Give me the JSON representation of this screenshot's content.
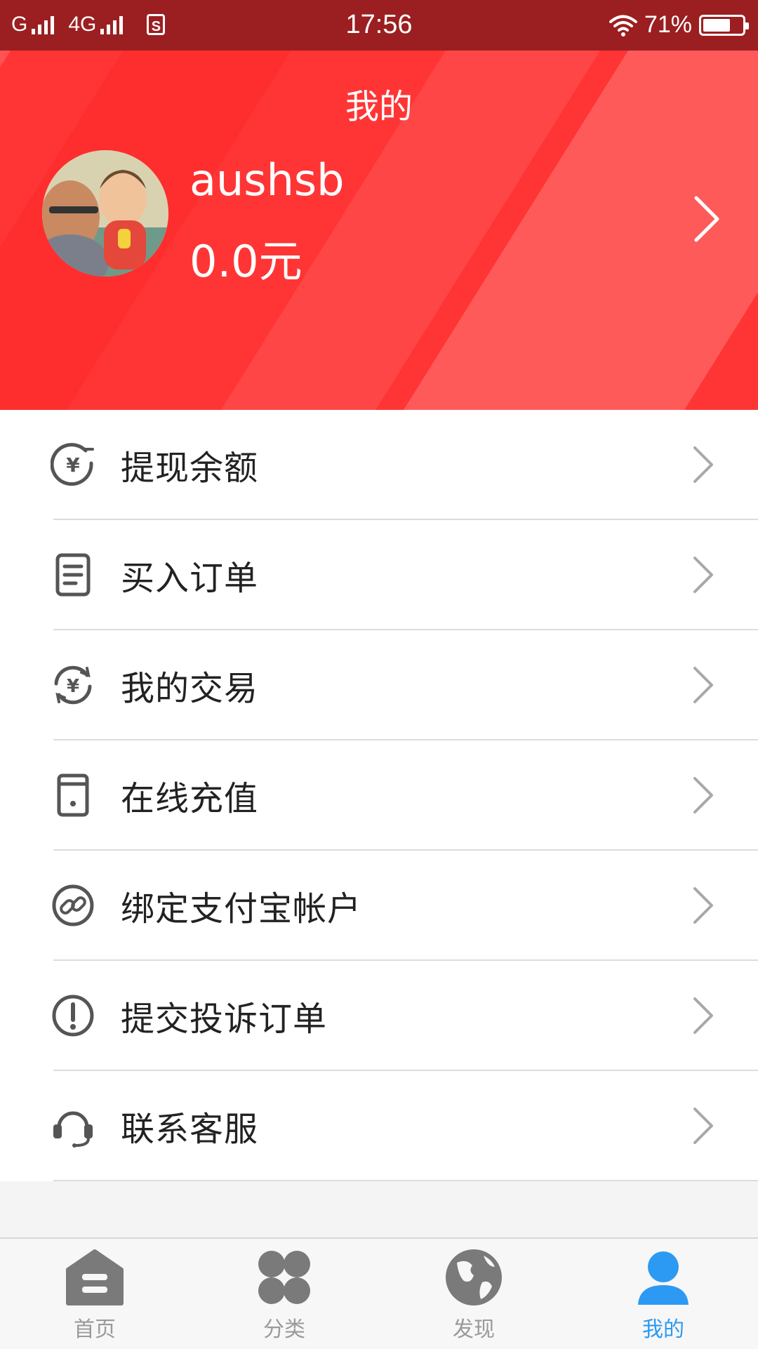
{
  "status_bar": {
    "carrier1": "G",
    "carrier2": "4G",
    "sim_label": "S",
    "time": "17:56",
    "battery": "71%",
    "battery_level": 0.71
  },
  "header": {
    "title": "我的",
    "username": "aushsb",
    "balance": "0.0元"
  },
  "menu": {
    "items": [
      {
        "label": "提现余额",
        "icon": "yen-withdraw-icon"
      },
      {
        "label": "买入订单",
        "icon": "order-document-icon"
      },
      {
        "label": "我的交易",
        "icon": "yen-exchange-icon"
      },
      {
        "label": "在线充值",
        "icon": "recharge-card-icon"
      },
      {
        "label": "绑定支付宝帐户",
        "icon": "link-icon"
      },
      {
        "label": "提交投诉订单",
        "icon": "warning-icon"
      },
      {
        "label": "联系客服",
        "icon": "headset-icon"
      }
    ]
  },
  "tabbar": {
    "tabs": [
      {
        "label": "首页",
        "icon": "home-icon"
      },
      {
        "label": "分类",
        "icon": "category-grid-icon"
      },
      {
        "label": "发现",
        "icon": "globe-icon"
      },
      {
        "label": "我的",
        "icon": "user-icon",
        "active": true
      }
    ]
  },
  "colors": {
    "status_bar": "#9b1f20",
    "header_red": "#ff3535",
    "active_tab": "#2c9af2",
    "inactive_tab": "#9a9a9a"
  }
}
